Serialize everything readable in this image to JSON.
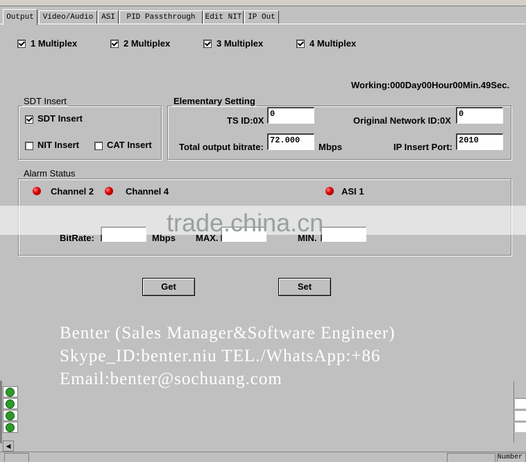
{
  "tabs": [
    {
      "label": "Output",
      "active": true
    },
    {
      "label": "Video/Audio",
      "active": false
    },
    {
      "label": "ASI",
      "active": false
    },
    {
      "label": "PID Passthrough",
      "active": false
    },
    {
      "label": "Edit NIT",
      "active": false
    },
    {
      "label": "IP Out",
      "active": false
    }
  ],
  "multiplex": [
    {
      "label": "1 Multiplex",
      "checked": true
    },
    {
      "label": "2 Multiplex",
      "checked": true
    },
    {
      "label": "3 Multiplex",
      "checked": true
    },
    {
      "label": "4 Multiplex",
      "checked": true
    }
  ],
  "working_status": "Working:000Day00Hour00Min.49Sec.",
  "sdt_group": {
    "title": "SDT Insert",
    "sdt_insert": {
      "label": "SDT Insert",
      "checked": true
    },
    "nit_insert": {
      "label": "NIT Insert",
      "checked": false
    },
    "cat_insert": {
      "label": "CAT Insert",
      "checked": false
    }
  },
  "elementary": {
    "title": "Elementary Setting",
    "ts_id_label": "TS ID:0X",
    "ts_id_value": "0",
    "onid_label": "Original Network ID:0X",
    "onid_value": "0",
    "bitrate_label": "Total output bitrate:",
    "bitrate_value": "72.000",
    "bitrate_unit": "Mbps",
    "ip_port_label": "IP Insert Port:",
    "ip_port_value": "2010"
  },
  "alarm": {
    "title": "Alarm Status",
    "items": [
      "Channel 2",
      "Channel 4",
      "ASI 1"
    ],
    "bitrate_label": "BitRate:",
    "bitrate_unit": "Mbps",
    "max_label": "MAX.",
    "min_label": "MIN."
  },
  "buttons": {
    "get": "Get",
    "set": "Set"
  },
  "watermark": "trade.china.cn",
  "overlay": {
    "line1": "Benter (Sales Manager&Software Engineer)",
    "line2": "Skype_ID:benter.niu  TEL./WhatsApp:+86",
    "line3": "Email:benter@sochuang.com"
  },
  "status_bar": {
    "number_label": "Number"
  },
  "colors": {
    "background": "#c0c0c0",
    "led": "#e00000",
    "tree_icon": "#2e9a2e"
  }
}
